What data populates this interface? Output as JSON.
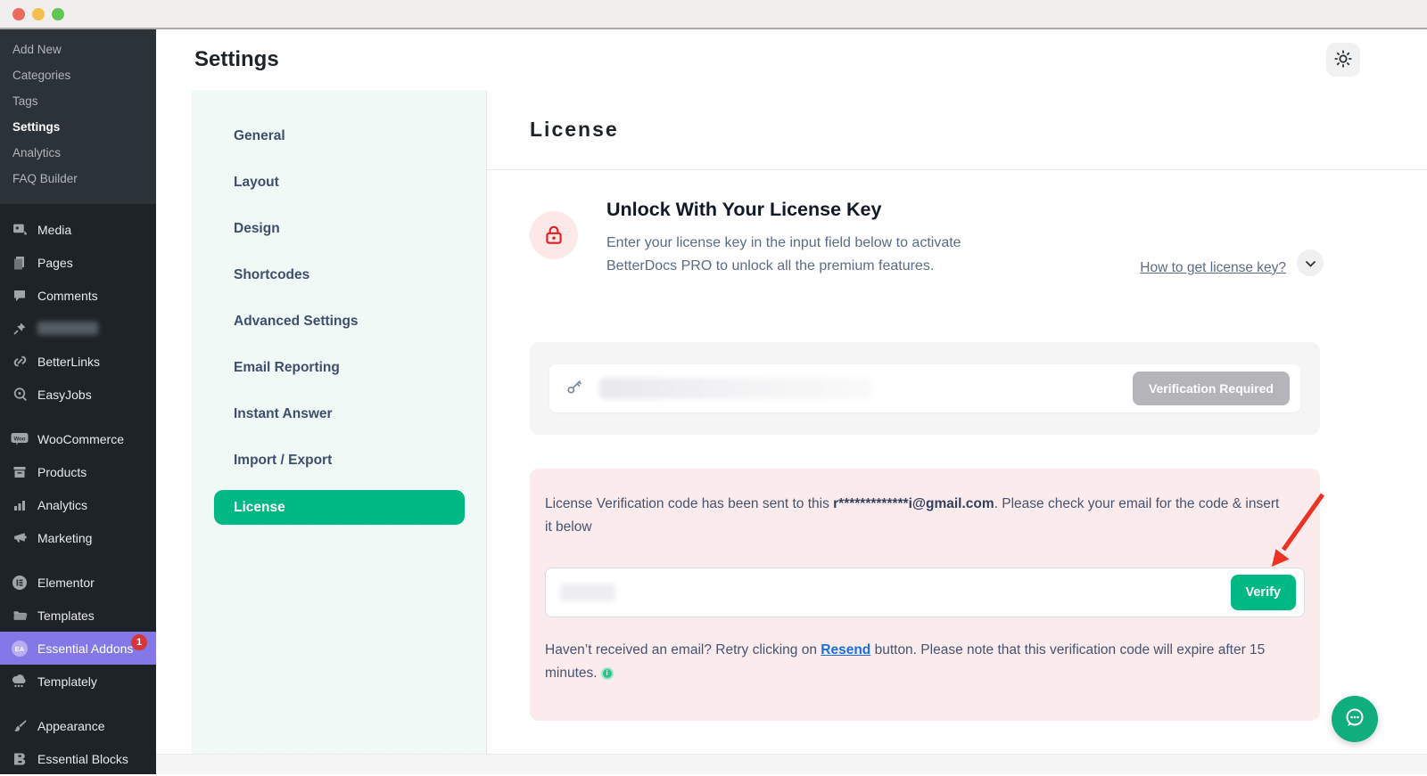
{
  "sidebar": {
    "submenu": [
      {
        "label": "Add New"
      },
      {
        "label": "Categories"
      },
      {
        "label": "Tags"
      },
      {
        "label": "Settings"
      },
      {
        "label": "Analytics"
      },
      {
        "label": "FAQ Builder"
      }
    ],
    "menu": [
      {
        "icon": "media-icon",
        "label": "Media"
      },
      {
        "icon": "pages-icon",
        "label": "Pages"
      },
      {
        "icon": "comments-icon",
        "label": "Comments"
      },
      {
        "icon": "pin-icon",
        "label": ""
      },
      {
        "icon": "link-icon",
        "label": "BetterLinks"
      },
      {
        "icon": "easyjobs-icon",
        "label": "EasyJobs"
      },
      {
        "icon": "woocommerce-icon",
        "label": "WooCommerce"
      },
      {
        "icon": "products-icon",
        "label": "Products"
      },
      {
        "icon": "analytics-icon",
        "label": "Analytics"
      },
      {
        "icon": "marketing-icon",
        "label": "Marketing"
      },
      {
        "icon": "elementor-icon",
        "label": "Elementor"
      },
      {
        "icon": "templates-icon",
        "label": "Templates"
      },
      {
        "icon": "essential-addons-icon",
        "label": "Essential Addons",
        "badge": "1"
      },
      {
        "icon": "templately-icon",
        "label": "Templately"
      },
      {
        "icon": "appearance-icon",
        "label": "Appearance"
      },
      {
        "icon": "essential-blocks-icon",
        "label": "Essential Blocks"
      }
    ]
  },
  "header": {
    "title": "Settings"
  },
  "settings_nav": {
    "items": [
      {
        "label": "General"
      },
      {
        "label": "Layout"
      },
      {
        "label": "Design"
      },
      {
        "label": "Shortcodes"
      },
      {
        "label": "Advanced Settings"
      },
      {
        "label": "Email Reporting"
      },
      {
        "label": "Instant Answer"
      },
      {
        "label": "Import / Export"
      },
      {
        "label": "License"
      }
    ]
  },
  "license_page": {
    "title": "License",
    "unlock": {
      "heading": "Unlock With Your License Key",
      "description": "Enter your license key in the input field below to activate BetterDocs PRO to unlock all the premium features.",
      "help_link": "How to get license key?"
    },
    "license_field": {
      "status_button": "Verification Required"
    },
    "verification": {
      "message_prefix": "License Verification code has been sent to this ",
      "email": "r*************i@gmail.com",
      "message_suffix": ". Please check your email for the code & insert it below",
      "verify_button": "Verify",
      "resend_prefix": "Haven’t received an email? Retry clicking on ",
      "resend_link": "Resend",
      "resend_suffix": " button. Please note that this verification code will expire after 15 minutes.",
      "info_glyph": "i"
    }
  },
  "colors": {
    "accent_green": "#00b884",
    "sidebar_active_purple": "#8478e8",
    "badge_red": "#d63638",
    "pink_panel": "#fcebec",
    "arrow_red": "#ec3323"
  }
}
